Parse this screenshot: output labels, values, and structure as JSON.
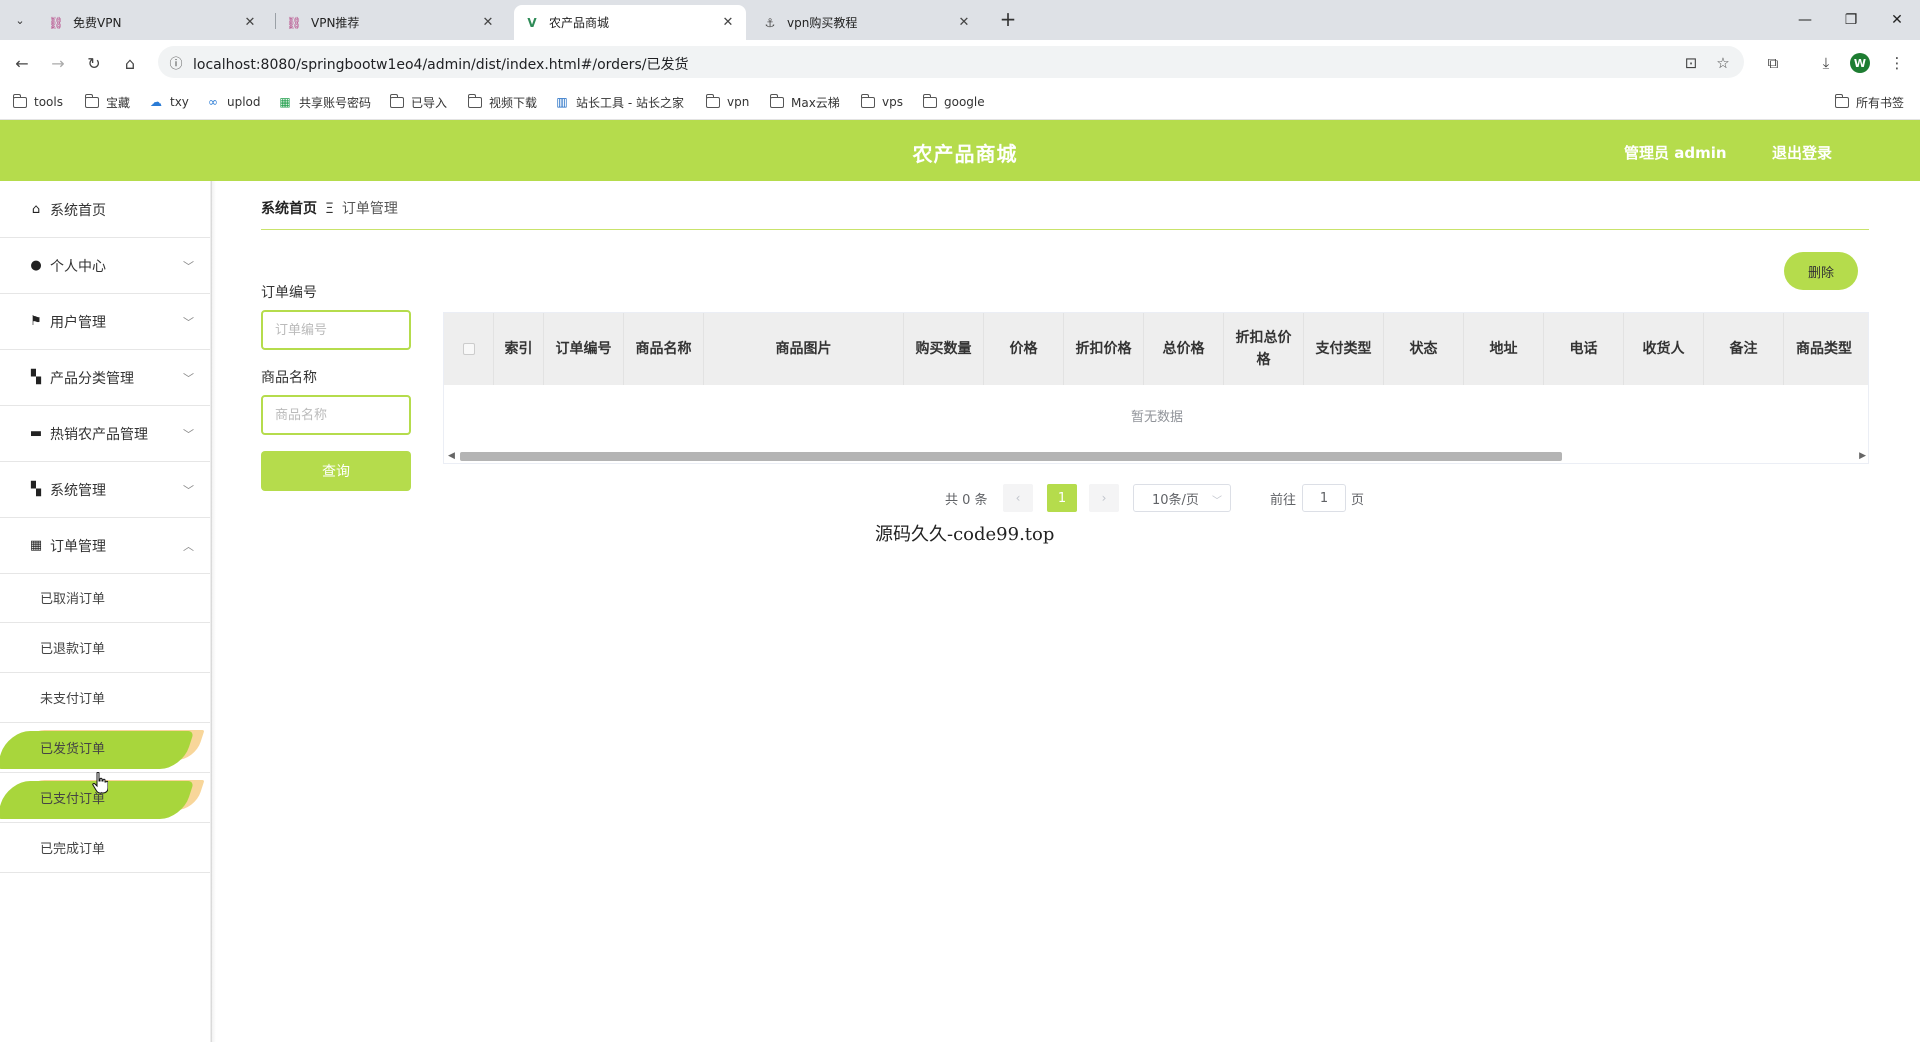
{
  "browser": {
    "tabs": [
      {
        "title": "免费VPN",
        "active": false
      },
      {
        "title": "VPN推荐",
        "active": false
      },
      {
        "title": "农产品商城",
        "active": true
      },
      {
        "title": "vpn购买教程",
        "active": false
      }
    ],
    "url": "localhost:8080/springbootw1eo4/admin/dist/index.html#/orders/已发货",
    "profile_initial": "W",
    "bookmarks": [
      "tools",
      "宝藏",
      "txy",
      "uplod",
      "共享账号密码",
      "已导入",
      "视频下载",
      "站长工具 - 站长之家",
      "vpn",
      "Max云梯",
      "vps",
      "google"
    ],
    "all_bookmarks": "所有书签"
  },
  "header": {
    "title": "农产品商城",
    "user": "管理员 admin",
    "logout": "退出登录",
    "color": "#b5dc4c"
  },
  "sidebar": {
    "items": [
      {
        "label": "系统首页",
        "icon": "home-icon"
      },
      {
        "label": "个人中心",
        "icon": "user-icon"
      },
      {
        "label": "用户管理",
        "icon": "flag-icon"
      },
      {
        "label": "产品分类管理",
        "icon": "grid-icon"
      },
      {
        "label": "热销农产品管理",
        "icon": "chat-icon"
      },
      {
        "label": "系统管理",
        "icon": "grid-icon"
      },
      {
        "label": "订单管理",
        "icon": "apps-icon"
      }
    ],
    "sub_items": [
      {
        "label": "已取消订单",
        "highlight": false
      },
      {
        "label": "已退款订单",
        "highlight": false
      },
      {
        "label": "未支付订单",
        "highlight": false
      },
      {
        "label": "已发货订单",
        "highlight": true
      },
      {
        "label": "已支付订单",
        "highlight": true
      },
      {
        "label": "已完成订单",
        "highlight": false
      }
    ]
  },
  "breadcrumb": {
    "home": "系统首页",
    "separator": "Ξ",
    "current": "订单管理"
  },
  "search": {
    "order_label": "订单编号",
    "order_placeholder": "订单编号",
    "name_label": "商品名称",
    "name_placeholder": "商品名称",
    "button": "查询"
  },
  "actions": {
    "delete": "删除"
  },
  "table": {
    "columns": [
      "索引",
      "订单编号",
      "商品名称",
      "商品图片",
      "购买数量",
      "价格",
      "折扣价格",
      "总价格",
      "折扣总价格",
      "支付类型",
      "状态",
      "地址",
      "电话",
      "收货人",
      "备注",
      "商品类型"
    ],
    "empty_text": "暂无数据"
  },
  "pagination": {
    "total": "共 0 条",
    "current_page": "1",
    "page_size": "10条/页",
    "goto_label": "前往",
    "goto_value": "1",
    "page_suffix": "页"
  },
  "watermark": "源码久久-code99.top"
}
